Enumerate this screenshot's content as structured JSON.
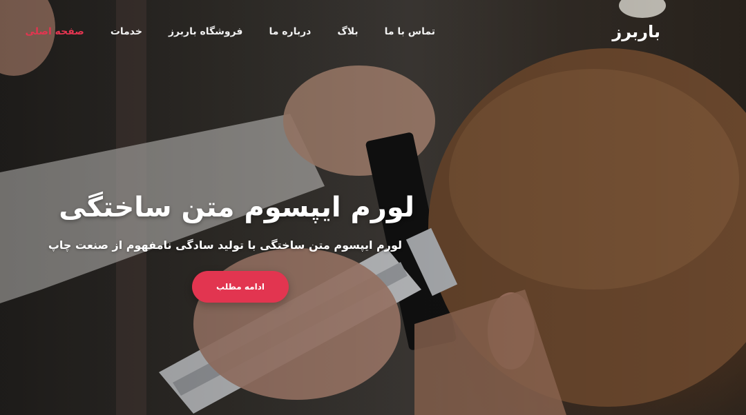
{
  "brand": {
    "logo_text": "باربرز"
  },
  "nav": {
    "items": [
      {
        "label": "صفحه اصلی",
        "active": true
      },
      {
        "label": "خدمات",
        "active": false
      },
      {
        "label": "فروشگاه باربرز",
        "active": false
      },
      {
        "label": "درباره ما",
        "active": false
      },
      {
        "label": "بلاگ",
        "active": false
      },
      {
        "label": "تماس با ما",
        "active": false
      }
    ]
  },
  "hero": {
    "title": "لورم ایپسوم متن ساختگی",
    "subtitle": "لورم ایپسوم متن ساختگی با تولید سادگی نامفهوم از صنعت چاپ",
    "cta_label": "ادامه مطلب",
    "background_image": "barber-trimming-hair-photo"
  },
  "colors": {
    "accent": "#e23550",
    "text": "#ffffff"
  }
}
